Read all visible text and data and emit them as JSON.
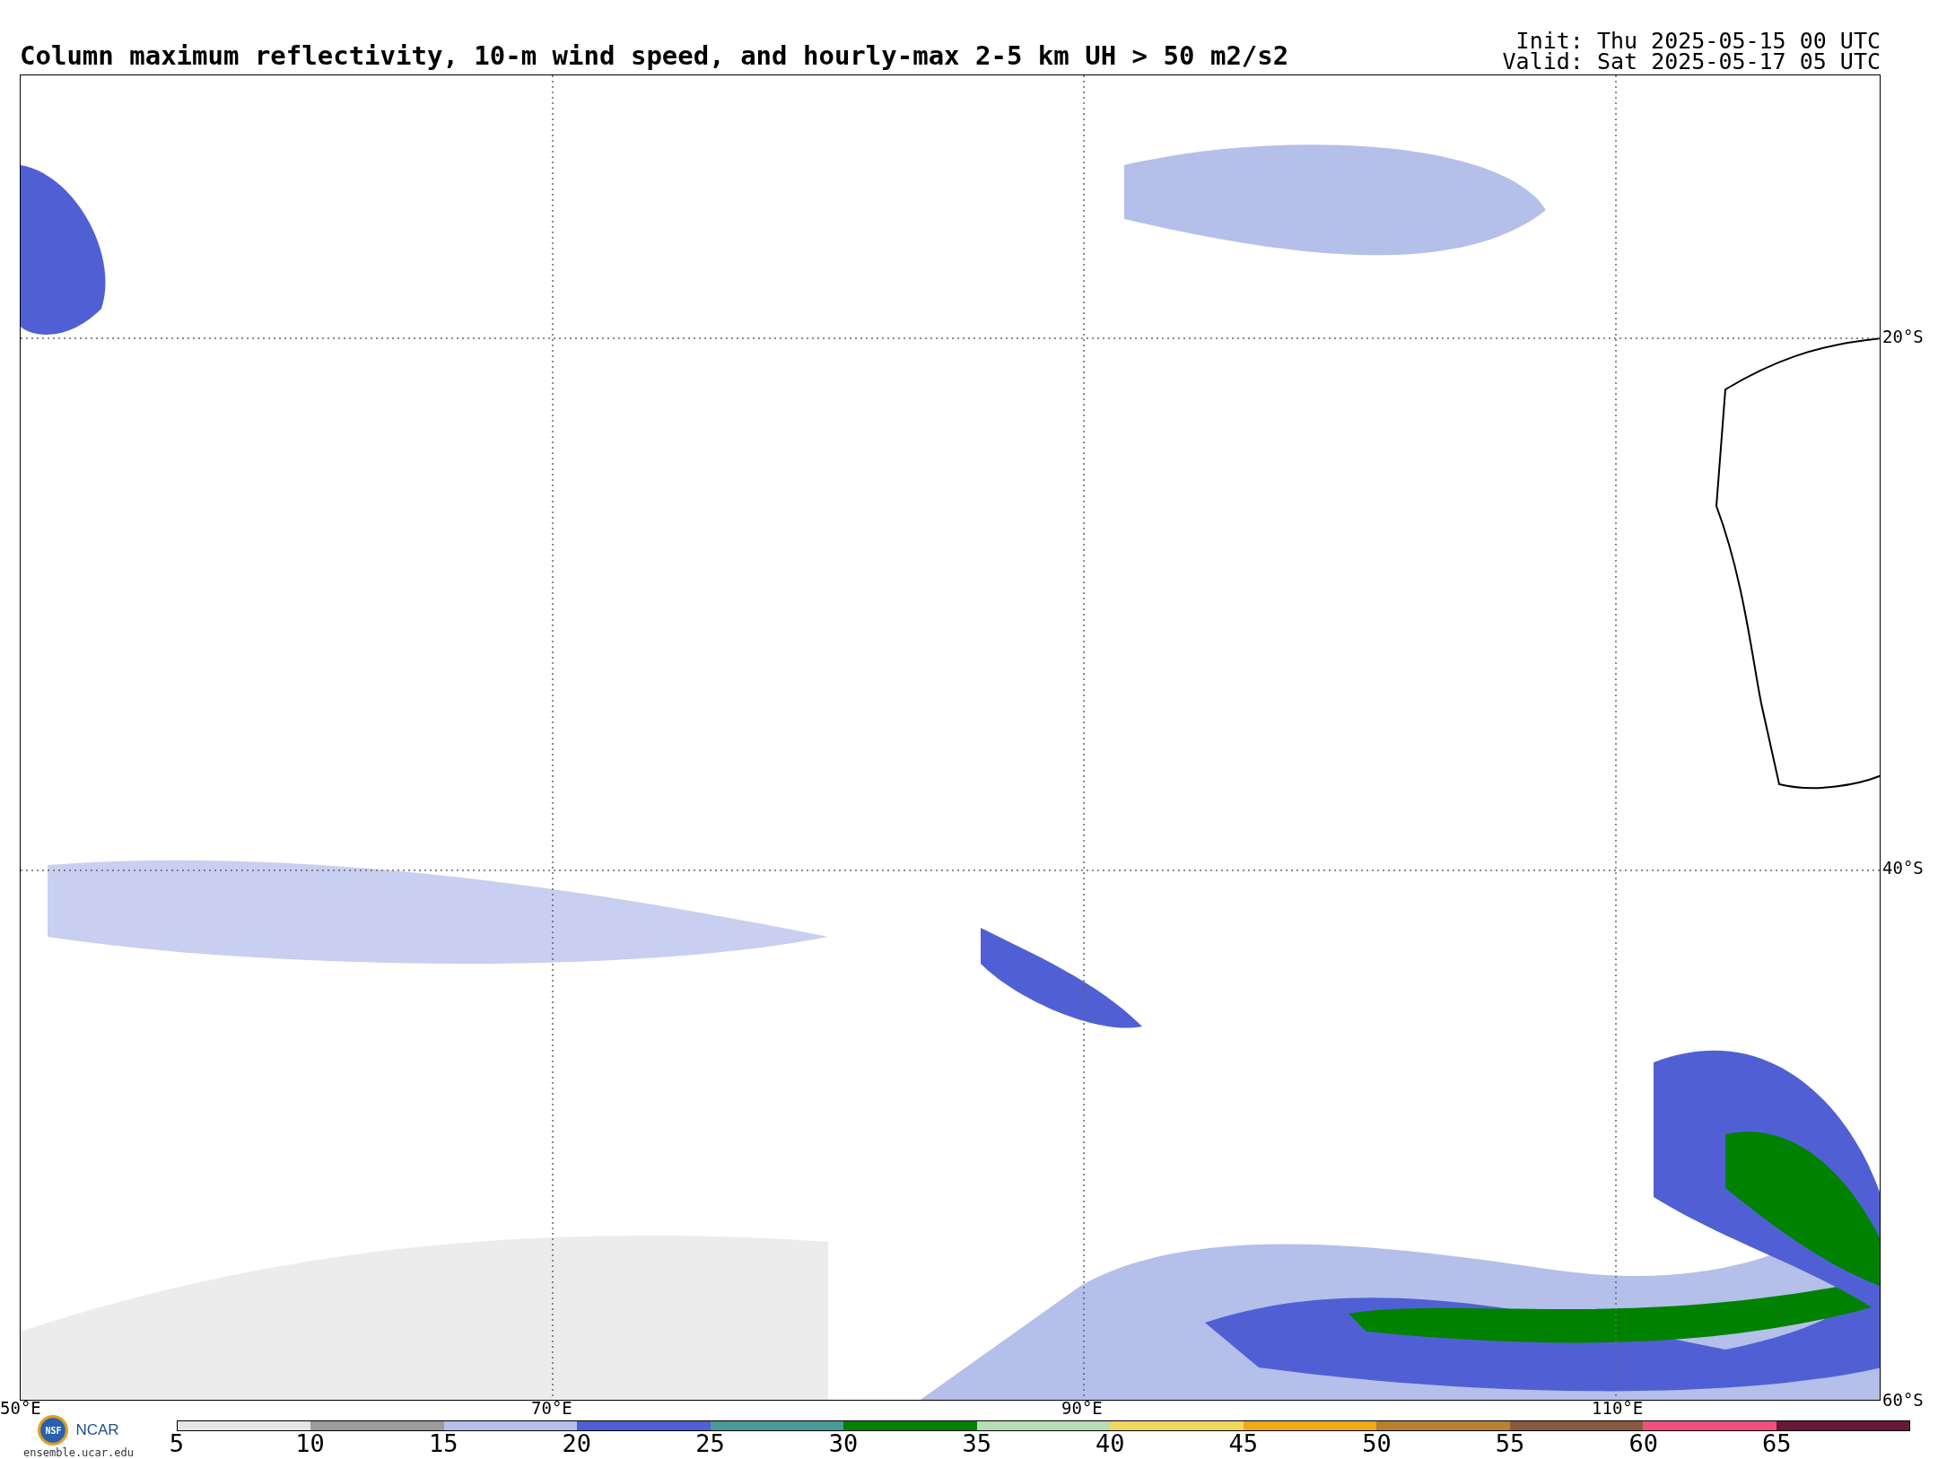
{
  "title": "Column maximum reflectivity, 10-m wind speed, and hourly-max 2-5 km UH > 50 m2/s2",
  "init": "Init: Thu 2025-05-15 00 UTC",
  "valid": "Valid: Sat 2025-05-17 05 UTC",
  "map": {
    "lat_labels": [
      "20°S",
      "40°S",
      "60°S"
    ],
    "lon_labels": [
      "50°E",
      "70°E",
      "90°E",
      "110°E"
    ]
  },
  "logos": {
    "nsf": "NSF",
    "ncar": "NCAR",
    "url": "ensemble.ucar.edu"
  },
  "colorbar": {
    "segments": [
      {
        "color": "#e6e6e6"
      },
      {
        "color": "#9c9c9c"
      },
      {
        "color": "#b4bfea"
      },
      {
        "color": "#5060d4"
      },
      {
        "color": "#4a9a9a"
      },
      {
        "color": "#008200"
      },
      {
        "color": "#b8dcb8"
      },
      {
        "color": "#f0d860"
      },
      {
        "color": "#f0aa18"
      },
      {
        "color": "#b88030"
      },
      {
        "color": "#8a5a3e"
      },
      {
        "color": "#f05080"
      },
      {
        "color": "#681838"
      }
    ],
    "ticks": [
      "5",
      "10",
      "15",
      "20",
      "25",
      "30",
      "35",
      "40",
      "45",
      "50",
      "55",
      "60",
      "65"
    ]
  }
}
